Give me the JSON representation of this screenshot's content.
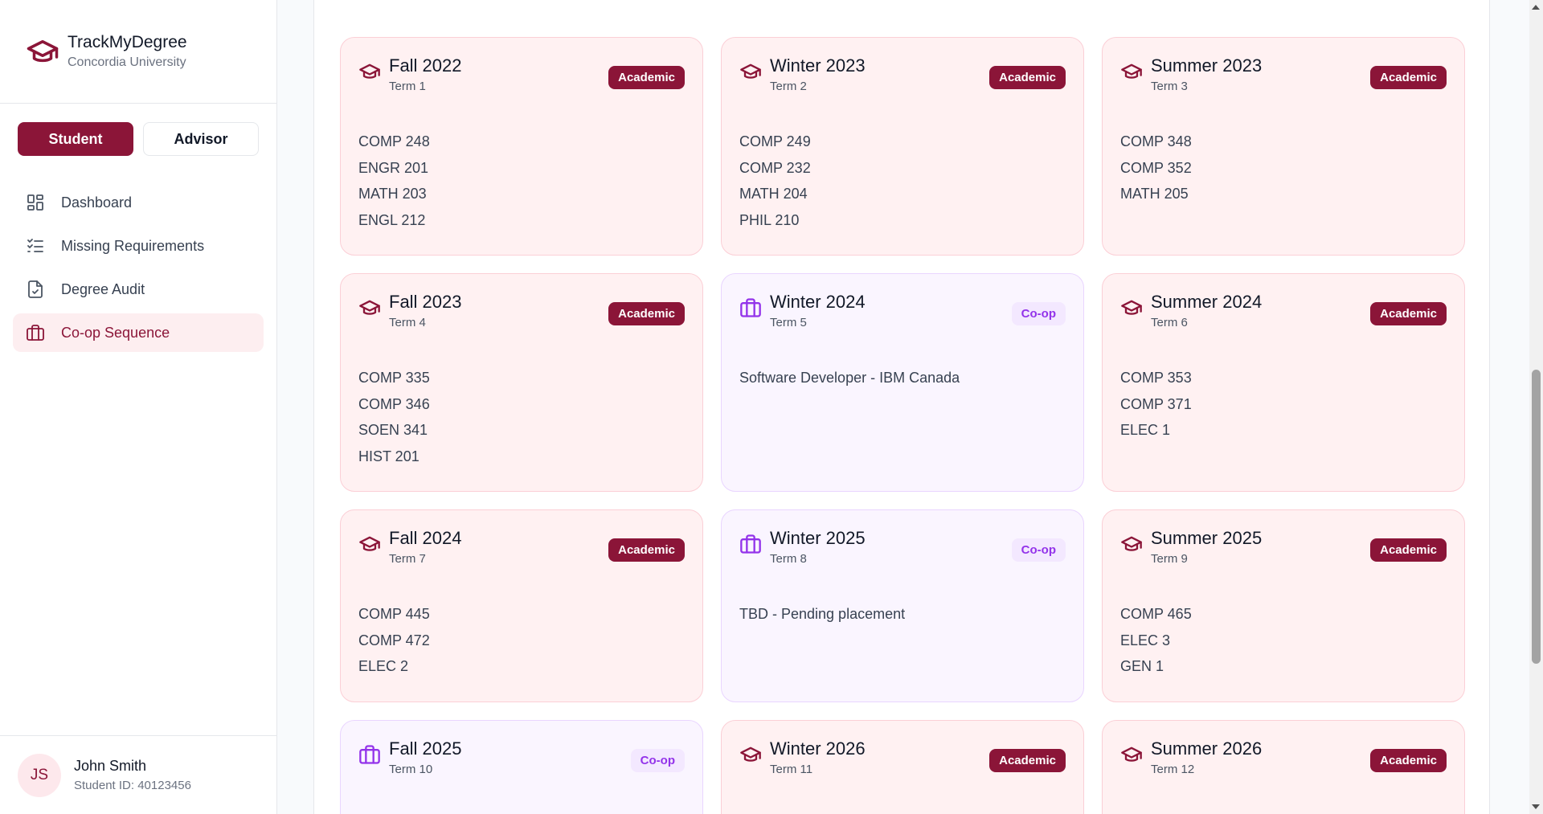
{
  "app": {
    "name": "TrackMyDegree",
    "university": "Concordia University",
    "brand_color": "#8b1538",
    "coop_color": "#9333ea"
  },
  "roles": {
    "student": "Student",
    "advisor": "Advisor",
    "selected": "Student"
  },
  "nav": [
    {
      "label": "Dashboard",
      "icon": "dashboard-icon",
      "active": false
    },
    {
      "label": "Missing Requirements",
      "icon": "checklist-icon",
      "active": false
    },
    {
      "label": "Degree Audit",
      "icon": "file-check-icon",
      "active": false
    },
    {
      "label": "Co-op Sequence",
      "icon": "briefcase-icon",
      "active": true
    }
  ],
  "user": {
    "initials": "JS",
    "name": "John Smith",
    "student_id": "Student ID: 40123456"
  },
  "terms": [
    {
      "name": "Fall 2022",
      "term": "Term 1",
      "type": "Academic",
      "items": [
        "COMP 248",
        "ENGR 201",
        "MATH 203",
        "ENGL 212"
      ]
    },
    {
      "name": "Winter 2023",
      "term": "Term 2",
      "type": "Academic",
      "items": [
        "COMP 249",
        "COMP 232",
        "MATH 204",
        "PHIL 210"
      ]
    },
    {
      "name": "Summer 2023",
      "term": "Term 3",
      "type": "Academic",
      "items": [
        "COMP 348",
        "COMP 352",
        "MATH 205"
      ]
    },
    {
      "name": "Fall 2023",
      "term": "Term 4",
      "type": "Academic",
      "items": [
        "COMP 335",
        "COMP 346",
        "SOEN 341",
        "HIST 201"
      ]
    },
    {
      "name": "Winter 2024",
      "term": "Term 5",
      "type": "Co-op",
      "items": [
        "Software Developer - IBM Canada"
      ]
    },
    {
      "name": "Summer 2024",
      "term": "Term 6",
      "type": "Academic",
      "items": [
        "COMP 353",
        "COMP 371",
        "ELEC 1"
      ]
    },
    {
      "name": "Fall 2024",
      "term": "Term 7",
      "type": "Academic",
      "items": [
        "COMP 445",
        "COMP 472",
        "ELEC 2"
      ]
    },
    {
      "name": "Winter 2025",
      "term": "Term 8",
      "type": "Co-op",
      "items": [
        "TBD - Pending placement"
      ]
    },
    {
      "name": "Summer 2025",
      "term": "Term 9",
      "type": "Academic",
      "items": [
        "COMP 465",
        "ELEC 3",
        "GEN 1"
      ]
    },
    {
      "name": "Fall 2025",
      "term": "Term 10",
      "type": "Co-op",
      "items": []
    },
    {
      "name": "Winter 2026",
      "term": "Term 11",
      "type": "Academic",
      "items": []
    },
    {
      "name": "Summer 2026",
      "term": "Term 12",
      "type": "Academic",
      "items": []
    }
  ]
}
